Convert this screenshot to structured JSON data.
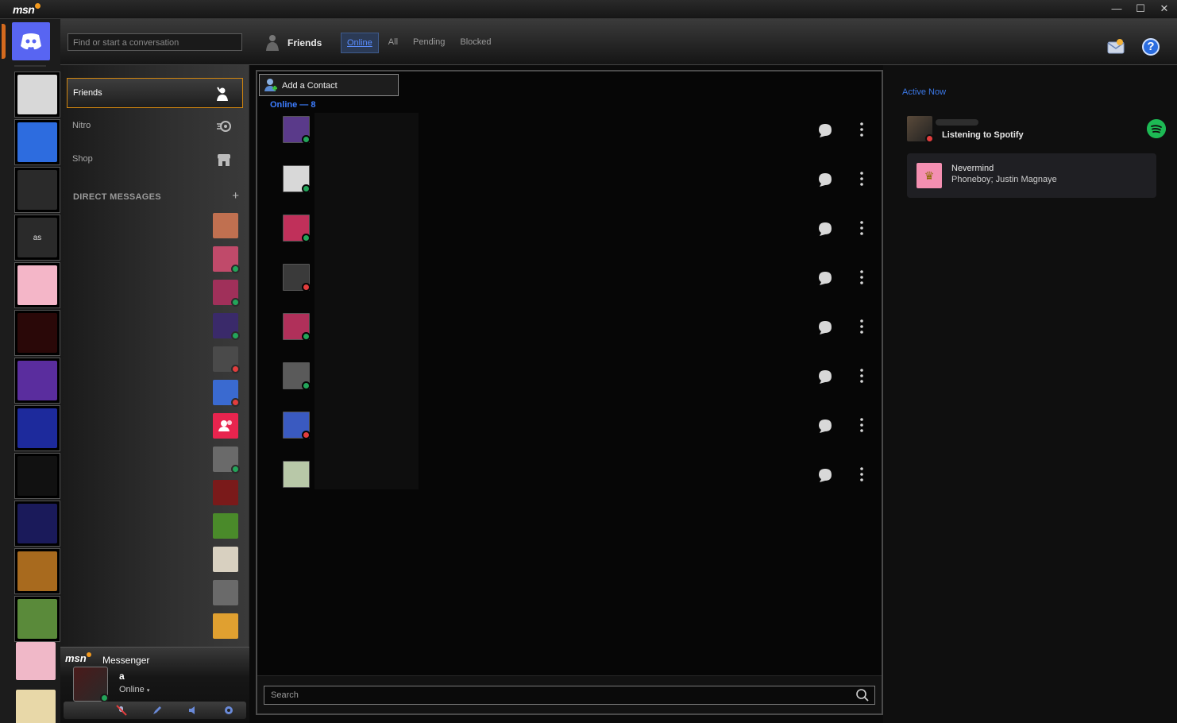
{
  "window": {
    "app_logo": "msn",
    "controls": [
      "—",
      "☐",
      "✕"
    ]
  },
  "topbar": {
    "search_placeholder": "Find or start a conversation",
    "section_title": "Friends",
    "tabs": [
      {
        "label": "Online",
        "active": true
      },
      {
        "label": "All",
        "active": false
      },
      {
        "label": "Pending",
        "active": false
      },
      {
        "label": "Blocked",
        "active": false
      }
    ],
    "inbox_icon": "inbox-icon",
    "help_icon": "help-icon"
  },
  "rail": {
    "home_icon": "discord-logo-icon",
    "servers": [
      {
        "name": "globe-server",
        "color": "#d8d8d8"
      },
      {
        "name": "b-server",
        "color": "#2d6cdf"
      },
      {
        "name": "alleylat-server",
        "color": "#2a2a2a"
      },
      {
        "name": "as-server",
        "label": "as",
        "color": "#2a2a2a"
      },
      {
        "name": "kuromi-server",
        "color": "#f4b6c8"
      },
      {
        "name": "party-server",
        "color": "#2a0808"
      },
      {
        "name": "windows-server",
        "color": "#5a2d9e"
      },
      {
        "name": "blue-art-server",
        "color": "#1d2a9c"
      },
      {
        "name": "qr-server",
        "color": "#111111"
      },
      {
        "name": "win95-server",
        "color": "#1a1a5a"
      },
      {
        "name": "reindev-server",
        "color": "#a86a1e"
      },
      {
        "name": "photo-server",
        "color": "#5a8a3a"
      },
      {
        "name": "pink-folder-server",
        "color": "#f0b8c8"
      },
      {
        "name": "folder-server-2",
        "color": "#e8d8a8"
      }
    ]
  },
  "sidebar": {
    "items": [
      {
        "label": "Friends",
        "icon": "friends-wave-icon",
        "active": true
      },
      {
        "label": "Nitro",
        "icon": "nitro-icon",
        "active": false
      },
      {
        "label": "Shop",
        "icon": "shop-icon",
        "active": false
      }
    ],
    "dm_header": "DIRECT MESSAGES",
    "dm_add": "+",
    "dms": [
      {
        "color": "#c07050",
        "status": "none"
      },
      {
        "color": "#c04a6a",
        "status": "online"
      },
      {
        "color": "#a0305a",
        "status": "online"
      },
      {
        "color": "#3a2a6a",
        "status": "online"
      },
      {
        "color": "#4a4a4a",
        "status": "dnd"
      },
      {
        "color": "#3a6ad0",
        "status": "dnd"
      },
      {
        "color": "#e8244e",
        "status": "none",
        "group": true
      },
      {
        "color": "#6a6a6a",
        "status": "online"
      },
      {
        "color": "#7a1a1a",
        "status": "none"
      },
      {
        "color": "#4a8a2a",
        "status": "none"
      },
      {
        "color": "#d8d0c0",
        "status": "none"
      },
      {
        "color": "#6a6a6a",
        "status": "none"
      },
      {
        "color": "#e0a030",
        "status": "none"
      }
    ]
  },
  "user_panel": {
    "brand": "msn",
    "title": "Messenger",
    "username": "a",
    "status": "Online",
    "tools": [
      "mute-icon",
      "pen-icon",
      "speaker-icon",
      "settings-gear-icon"
    ]
  },
  "main": {
    "add_contact_label": "Add a Contact",
    "online_header": "Online — 8",
    "friends": [
      {
        "color": "#5a3a8a",
        "status": "online"
      },
      {
        "color": "#d8d8d8",
        "status": "online"
      },
      {
        "color": "#c0305a",
        "status": "online"
      },
      {
        "color": "#3a3a3a",
        "status": "dnd"
      },
      {
        "color": "#b0305a",
        "status": "online"
      },
      {
        "color": "#5a5a5a",
        "status": "online"
      },
      {
        "color": "#3a5ac0",
        "status": "dnd"
      },
      {
        "color": "#b8c8a8",
        "status": "none"
      }
    ],
    "search_placeholder": "Search"
  },
  "active_now": {
    "title": "Active Now",
    "activity": "Listening to Spotify",
    "song": "Nevermind",
    "artist": "Phoneboy; Justin Magnaye"
  },
  "colors": {
    "accent_orange": "#d2860f",
    "discord_blurple": "#5865f2",
    "online": "#23a55a",
    "dnd": "#e23d3d",
    "link_blue": "#3d7dff",
    "spotify_green": "#1db954"
  }
}
